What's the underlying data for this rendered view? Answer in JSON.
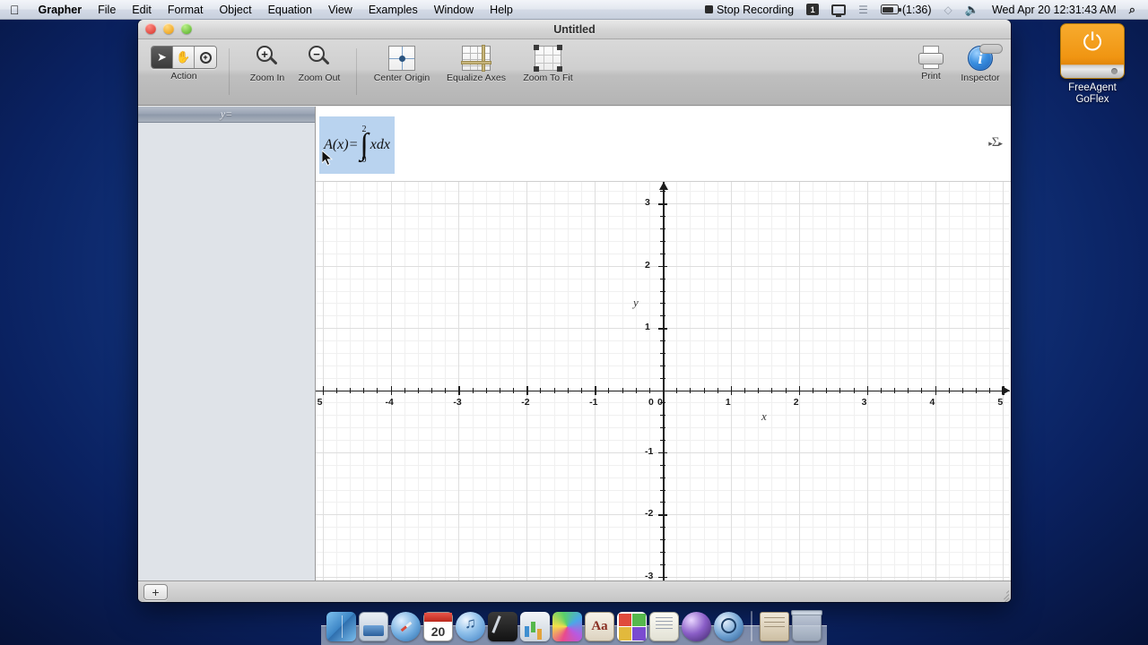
{
  "menubar": {
    "apple_icon": "apple-logo",
    "app_name": "Grapher",
    "items": [
      "File",
      "Edit",
      "Format",
      "Object",
      "Equation",
      "View",
      "Examples",
      "Window",
      "Help"
    ],
    "status": {
      "recording_label": "Stop Recording",
      "input_menu": "1",
      "battery_time": "(1:36)",
      "datetime": "Wed Apr 20  12:31:43 AM",
      "icons": [
        "record-stop-icon",
        "input-source-icon",
        "display-mirroring-icon",
        "bluetooth-icon",
        "battery-icon",
        "wifi-icon",
        "volume-icon",
        "spotlight-search-icon"
      ]
    }
  },
  "desktop": {
    "drive_label_line1": "FreeAgent",
    "drive_label_line2": "GoFlex",
    "drive_icon": "usb-external-drive-icon"
  },
  "window": {
    "title": "Untitled",
    "traffic_lights": [
      "close",
      "minimize",
      "zoom"
    ]
  },
  "toolbar": {
    "groups": [
      {
        "label": "Action",
        "icon": "action-segmented-control",
        "segments": [
          {
            "name": "pointer-tool",
            "glyph": "➤",
            "selected": true
          },
          {
            "name": "hand-tool",
            "glyph": "✋",
            "selected": false
          },
          {
            "name": "magnifier-tool",
            "glyph": "+",
            "selected": false
          }
        ]
      },
      {
        "label": "Zoom In",
        "icon": "zoom-in-icon",
        "glyph": "+"
      },
      {
        "label": "Zoom Out",
        "icon": "zoom-out-icon",
        "glyph": "−"
      },
      {
        "label": "Center Origin",
        "icon": "center-origin-icon"
      },
      {
        "label": "Equalize Axes",
        "icon": "equalize-axes-icon"
      },
      {
        "label": "Zoom To Fit",
        "icon": "zoom-to-fit-icon"
      },
      {
        "label": "Print",
        "icon": "printer-icon"
      },
      {
        "label": "Inspector",
        "icon": "info-circle-icon",
        "glyph": "i"
      }
    ]
  },
  "sidebar": {
    "header_icon": "y-equals-icon",
    "header_label": "y=",
    "items": []
  },
  "equation_bar": {
    "selected": true,
    "lhs": "A(x)=",
    "integral": {
      "upper_limit": "2",
      "lower_limit": "0",
      "symbol": "∫",
      "integrand": "xdx"
    },
    "full_text": "A(x)=∫₀² xdx",
    "sigma_button": "Σ",
    "sigma_button_name": "summation-palette-button",
    "cursor": "mouse-pointer"
  },
  "bottombar": {
    "add_label": "+",
    "add_name": "add-equation-button",
    "resize_grip": "resize-grip"
  },
  "chart_data": {
    "type": "line",
    "title": "",
    "xlabel": "x",
    "ylabel": "y",
    "xlim": [
      -5.1,
      5.1
    ],
    "ylim": [
      -3.35,
      3.35
    ],
    "xticks": [
      -5,
      -4,
      -3,
      -2,
      -1,
      0,
      1,
      2,
      3,
      4,
      5
    ],
    "xticklabels": [
      "5",
      "-4",
      "-3",
      "-2",
      "-1",
      "0",
      "1",
      "2",
      "3",
      "4",
      "5"
    ],
    "yticks": [
      -3,
      -2,
      -1,
      0,
      1,
      2,
      3
    ],
    "yticklabels": [
      "-3",
      "-2",
      "-1",
      "0",
      "1",
      "2",
      "3"
    ],
    "minor_ticks_per_unit": 5,
    "grid": true,
    "grid_major_color": "#dedede",
    "grid_minor_color": "#f2f2f2",
    "axis_color": "#1c1c1c",
    "series": [
      {
        "name": "A(x)=∫₀² xdx",
        "values": [],
        "note": "no curve plotted"
      }
    ],
    "legend": false
  },
  "dock": {
    "items": [
      {
        "name": "finder",
        "cls": "di-finder"
      },
      {
        "name": "preview",
        "cls": "di-preview"
      },
      {
        "name": "safari",
        "cls": "di-safari"
      },
      {
        "name": "calendar",
        "cls": "di-cal",
        "day": "20"
      },
      {
        "name": "itunes",
        "cls": "di-itunes"
      },
      {
        "name": "sketchbook",
        "cls": "di-sketch"
      },
      {
        "name": "numbers",
        "cls": "di-numbers"
      },
      {
        "name": "grapher",
        "cls": "di-grapher"
      },
      {
        "name": "dictionary",
        "cls": "di-dict",
        "glyph": "Aa"
      },
      {
        "name": "windows",
        "cls": "di-win"
      },
      {
        "name": "notes",
        "cls": "di-notes"
      },
      {
        "name": "sphere-app",
        "cls": "di-sphere"
      },
      {
        "name": "preview-magnifier",
        "cls": "di-mag"
      },
      {
        "name": "downloads-stack",
        "cls": "di-stack"
      },
      {
        "name": "trash",
        "cls": "di-trash"
      }
    ]
  },
  "colors": {
    "desktop_blue": "#143a86",
    "selection_blue": "#b9d3ef",
    "drive_orange": "#f09512",
    "accent": "#3a8fe0"
  }
}
